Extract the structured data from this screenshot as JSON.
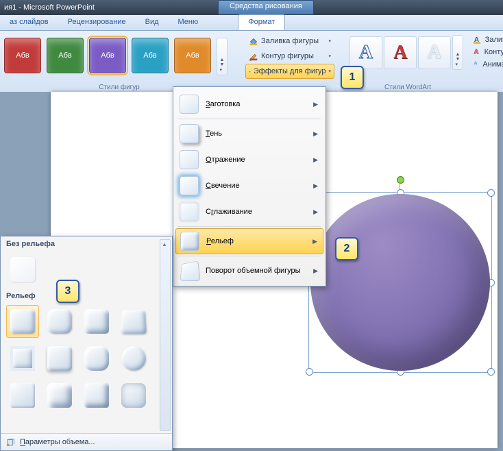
{
  "title": {
    "doc": "ия1",
    "app": "Microsoft PowerPoint",
    "context_tab": "Средства рисования"
  },
  "tabs": {
    "t1": "аз слайдов",
    "t2": "Рецензирование",
    "t3": "Вид",
    "t4": "Меню",
    "t5": "Формат"
  },
  "ribbon": {
    "swatch_label": "Абв",
    "styles_caption": "Стили фигур",
    "shape_fill": "Заливка фигуры",
    "shape_outline": "Контур фигуры",
    "shape_effects": "Эффекты для фигур",
    "wordart_caption": "Стили WordArt",
    "text_fill": "Заливка",
    "text_outline": "Контур т",
    "text_effects": "Анимаци",
    "swatch_colors": [
      "#c23b3b",
      "#3f8a3f",
      "#7a5cc4",
      "#2aa1c4",
      "#e08a2a"
    ]
  },
  "fx_menu": {
    "preset": "Заготовка",
    "shadow": "Тень",
    "reflection": "Отражение",
    "glow": "Свечение",
    "softedge": "Сглаживание",
    "bevel": "Рельеф",
    "rotation3d": "Поворот объемной фигуры"
  },
  "bevel": {
    "none_header": "Без рельефа",
    "header": "Рельеф",
    "footer": "Параметры объема..."
  },
  "callouts": {
    "c1": "1",
    "c2": "2",
    "c3": "3"
  }
}
